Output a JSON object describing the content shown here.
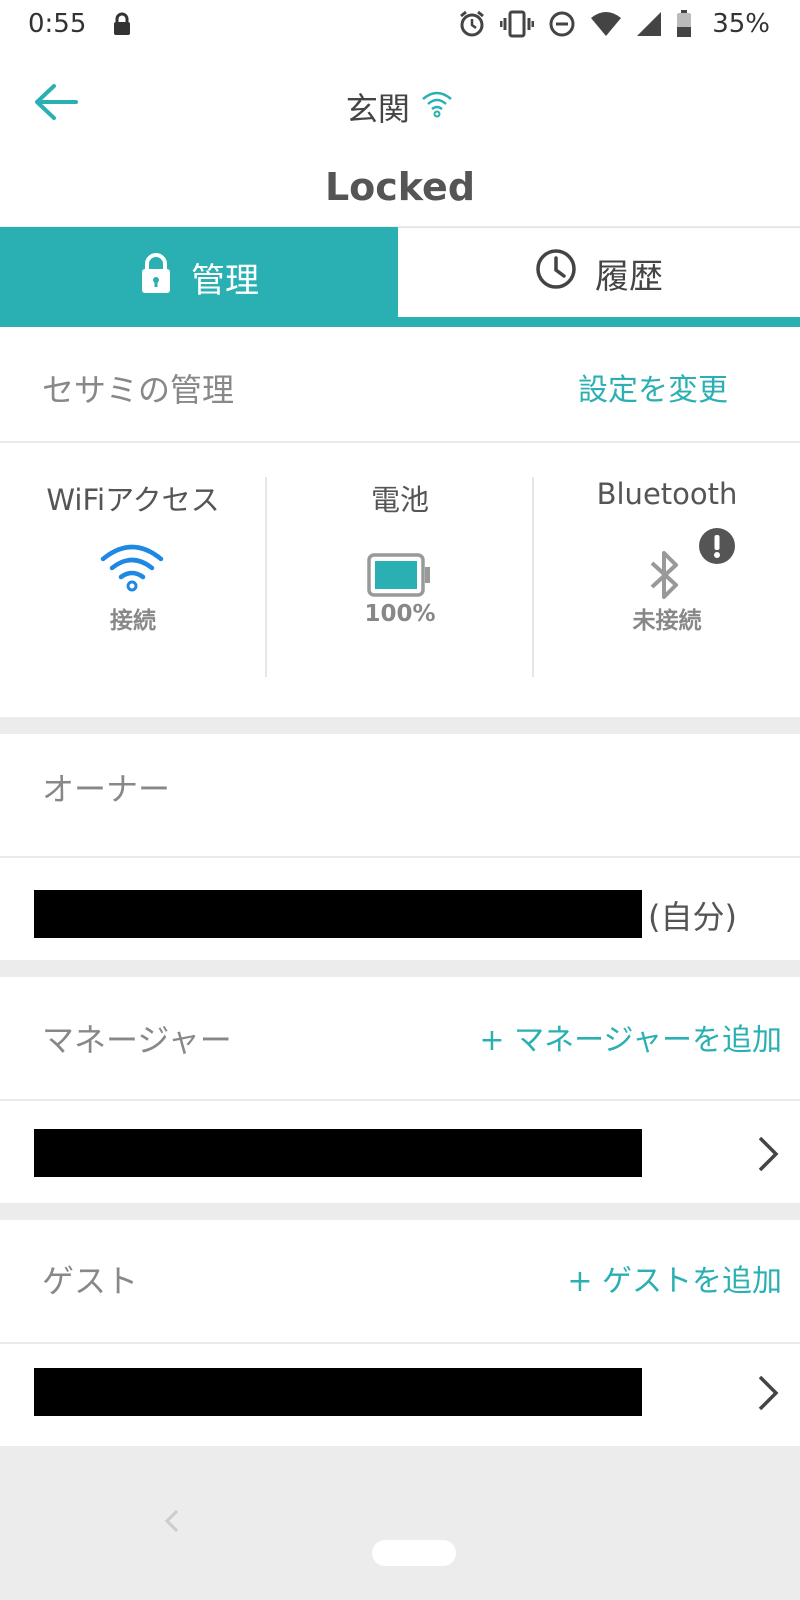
{
  "status_bar": {
    "time": "0:55",
    "battery_percent": "35%",
    "icons": [
      "lock-icon",
      "alarm-icon",
      "vibrate-icon",
      "dnd-icon",
      "wifi-icon",
      "signal-icon",
      "battery-icon"
    ]
  },
  "header": {
    "title": "玄関",
    "state": "Locked"
  },
  "tabs": [
    {
      "label": "管理",
      "icon": "lock-icon",
      "active": true
    },
    {
      "label": "履歴",
      "icon": "clock-icon",
      "active": false
    }
  ],
  "management": {
    "title": "セサミの管理",
    "action": "設定を変更"
  },
  "status_grid": {
    "wifi": {
      "label": "WiFiアクセス",
      "value": "接続"
    },
    "battery": {
      "label": "電池",
      "value": "100%"
    },
    "bluetooth": {
      "label": "Bluetooth",
      "value": "未接続"
    }
  },
  "owner": {
    "title": "オーナー",
    "self_suffix": "(自分)"
  },
  "manager": {
    "title": "マネージャー",
    "action": "+ マネージャーを追加"
  },
  "guest": {
    "title": "ゲスト",
    "action": "+ ゲストを追加"
  },
  "colors": {
    "accent": "#2ab0b2",
    "wifi_blue": "#1e88e5"
  }
}
